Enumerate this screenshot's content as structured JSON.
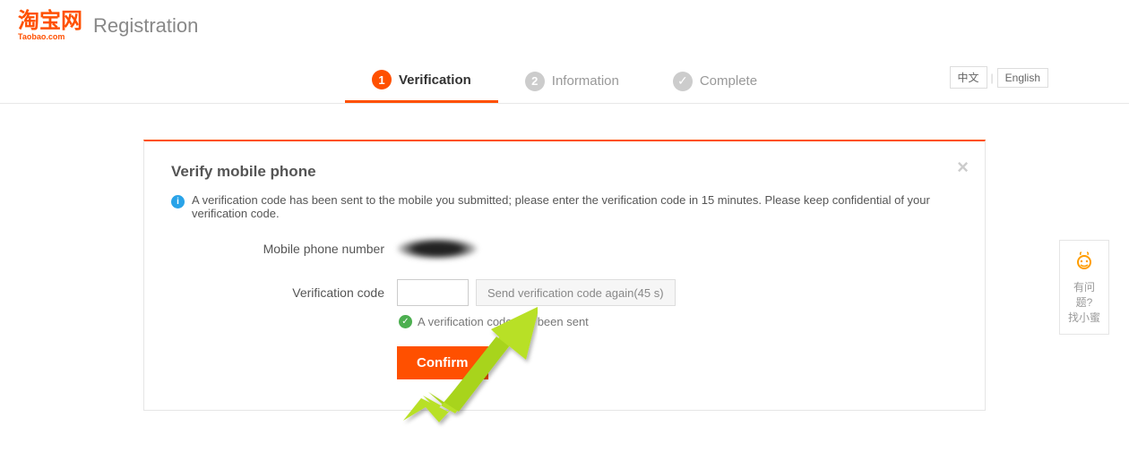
{
  "header": {
    "logo_cn": "淘宝网",
    "logo_en": "Taobao.com",
    "title": "Registration"
  },
  "steps": {
    "s1_num": "1",
    "s1_label": "Verification",
    "s2_num": "2",
    "s2_label": "Information",
    "s3_label": "Complete"
  },
  "lang": {
    "cn": "中文",
    "en": "English"
  },
  "panel": {
    "title": "Verify mobile phone",
    "notice": "A verification code has been sent to the mobile you submitted; please enter the verification code in 15 minutes. Please keep confidential of your verification code.",
    "label_phone": "Mobile phone number",
    "label_code": "Verification code",
    "resend": "Send verification code again(45 s)",
    "sent": "A verification code has been sent",
    "confirm": "Confirm"
  },
  "help": {
    "line1": "有问题?",
    "line2": "找小蜜"
  }
}
